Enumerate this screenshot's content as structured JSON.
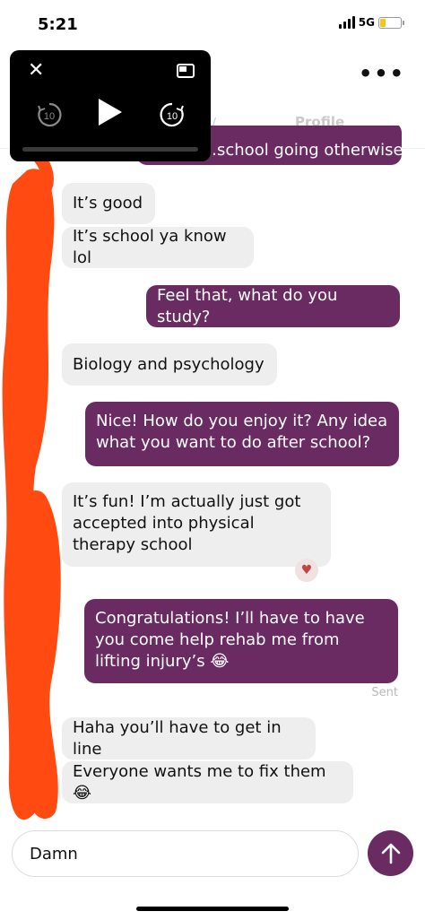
{
  "status_bar": {
    "time": "5:21",
    "network": "5G",
    "battery_level": 0.2,
    "battery_color": "#f5c518"
  },
  "header": {
    "more_icon": "ellipsis-icon",
    "tab_profile": "Profile"
  },
  "messages": [
    {
      "direction": "out",
      "text": "…school going otherwise?"
    },
    {
      "direction": "in",
      "text": "It’s good"
    },
    {
      "direction": "in",
      "text": "It’s school ya know lol"
    },
    {
      "direction": "out",
      "text": "Feel that, what do you study?"
    },
    {
      "direction": "in",
      "text": "Biology and psychology"
    },
    {
      "direction": "out",
      "text": "Nice! How do you enjoy it? Any idea what you want to do after school?"
    },
    {
      "direction": "in",
      "text": "It’s fun! I’m actually just got accepted into physical therapy school",
      "reaction": "heart-icon"
    },
    {
      "direction": "out",
      "text": "Congratulations! I’ll have to have you come help rehab me from lifting injury’s 😂",
      "status": "Sent"
    },
    {
      "direction": "in",
      "text": "Haha you’ll have to get in line"
    },
    {
      "direction": "in",
      "text": "Everyone wants me to fix them 😂"
    }
  ],
  "composer": {
    "value": "Damn",
    "send_icon": "arrow-up-icon"
  },
  "player": {
    "rewind_label": "10",
    "forward_label": "10"
  },
  "colors": {
    "accent": "#6a2b63",
    "incoming_bubble": "#eeeeee",
    "scribble": "#ff4a12"
  }
}
